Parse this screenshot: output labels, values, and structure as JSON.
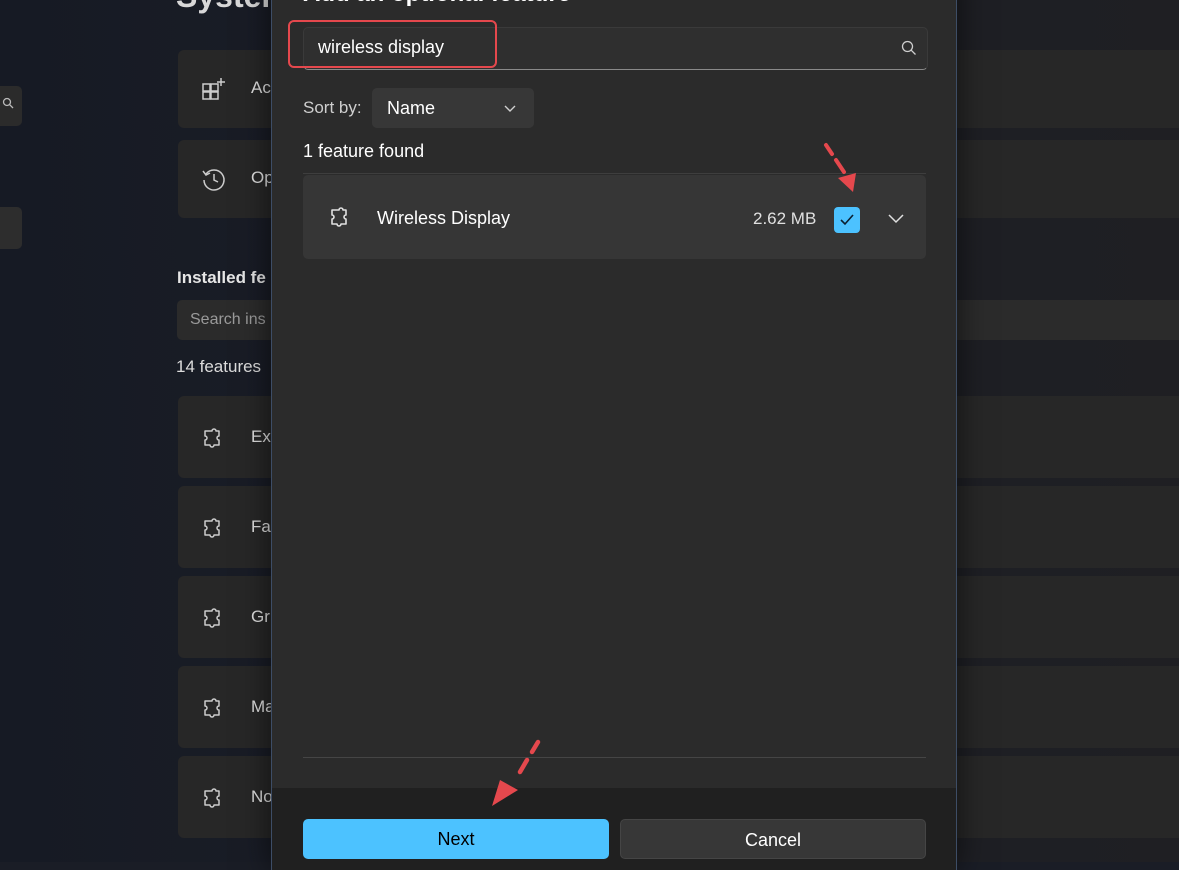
{
  "background": {
    "title": "Syster",
    "cards": [
      {
        "label": "Ac",
        "icon": "add-apps-icon"
      },
      {
        "label": "Op",
        "icon": "history-icon"
      }
    ],
    "installed_heading": "Installed fe",
    "search_placeholder": "Search ins",
    "features_count": "14 features",
    "rows": [
      {
        "label": "Ex"
      },
      {
        "label": "Fa"
      },
      {
        "label": "Gr"
      },
      {
        "label": "Ma"
      },
      {
        "label": "No"
      }
    ]
  },
  "dialog": {
    "title": "Add an optional feature",
    "search": {
      "value": "wireless display"
    },
    "sort": {
      "label": "Sort by:",
      "value": "Name"
    },
    "count": "1 feature found",
    "features": [
      {
        "name": "Wireless Display",
        "size": "2.62 MB",
        "checked": true
      }
    ],
    "buttons": {
      "next": "Next",
      "cancel": "Cancel"
    }
  },
  "colors": {
    "accent": "#4cc2ff",
    "annotation": "#e5484d",
    "dialog_bg": "#2b2b2b"
  }
}
